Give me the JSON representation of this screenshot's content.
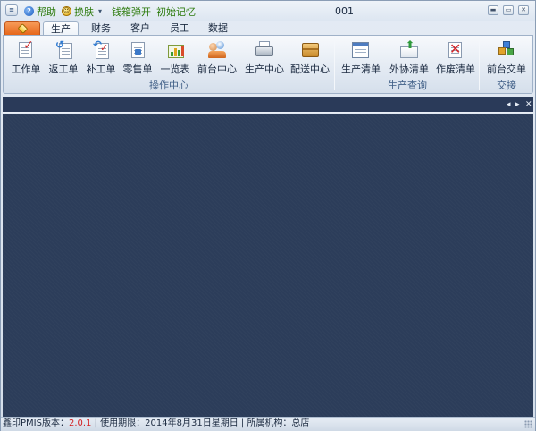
{
  "window": {
    "title": "001"
  },
  "quick_access": {
    "help": "帮助",
    "skin": "换肤",
    "popup": "钱箱弹开",
    "memory": "初始记忆"
  },
  "tabs": [
    "生产",
    "财务",
    "客户",
    "员工",
    "数据"
  ],
  "active_tab": "生产",
  "ribbon": {
    "groups": [
      {
        "label": "操作中心",
        "buttons": [
          "工作单",
          "返工单",
          "补工单",
          "零售单",
          "一览表",
          "前台中心",
          "生产中心",
          "配送中心"
        ]
      },
      {
        "label": "生产查询",
        "buttons": [
          "生产清单",
          "外协清单",
          "作废清单"
        ]
      },
      {
        "label": "交接",
        "buttons": [
          "前台交单"
        ]
      }
    ]
  },
  "status": {
    "version_label": "鑫印PMIS版本：",
    "version": "2.0.1",
    "sep1": " | ",
    "expiry_label": "使用期限：",
    "expiry": "2014年8月31日星期日",
    "sep2": " | ",
    "org_label": "所属机构：",
    "org": "总店"
  },
  "colors": {
    "workspace": "#2c3d5a",
    "dockbar": "#2a3a59",
    "app_button": "#e6661a",
    "version_text": "#d32020",
    "group_label": "#3f5e86",
    "quick_access_text": "#2b7a0b"
  },
  "icons": {
    "app": "app-logo-icon",
    "help": "help-icon",
    "skin": "skin-icon"
  }
}
